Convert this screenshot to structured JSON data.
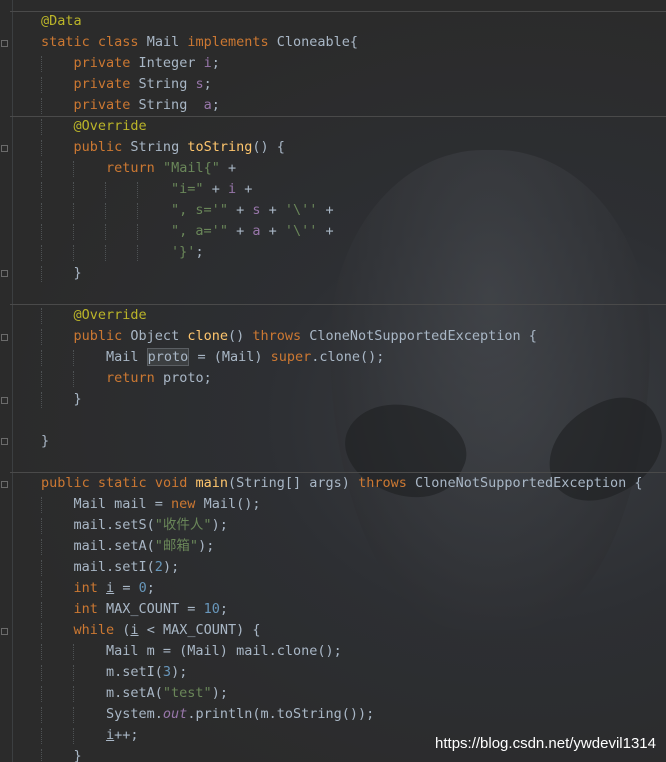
{
  "code_lines": [
    "@Data",
    "static class Mail implements Cloneable{",
    "    private Integer i;",
    "    private String s;",
    "    private String  a;",
    "    @Override",
    "    public String toString() {",
    "        return \"Mail{\" +",
    "                \"i=\" + i +",
    "                \", s='\" + s + '\\'' +",
    "                \", a='\" + a + '\\'' +",
    "                '}';",
    "    }",
    "",
    "    @Override",
    "    public Object clone() throws CloneNotSupportedException {",
    "        Mail proto = (Mail) super.clone();",
    "        return proto;",
    "    }",
    "",
    "}",
    "",
    "public static void main(String[] args) throws CloneNotSupportedException {",
    "    Mail mail = new Mail();",
    "    mail.setS(\"收件人\");",
    "    mail.setA(\"邮箱\");",
    "    mail.setI(2);",
    "    int i = 0;",
    "    int MAX_COUNT = 10;",
    "    while (i < MAX_COUNT) {",
    "        Mail m = (Mail) mail.clone();",
    "        m.setI(3);",
    "        m.setA(\"test\");",
    "        System.out.println(m.toString());",
    "        i++;",
    "    }"
  ],
  "watermark": "https://blog.csdn.net/ywdevil1314",
  "colors": {
    "background": "#2b2b2b",
    "keyword": "#cc7832",
    "annotation": "#bbb529",
    "string": "#6a8759",
    "number": "#6897bb",
    "field": "#9876aa",
    "method": "#ffc66d",
    "text": "#a9b7c6"
  }
}
